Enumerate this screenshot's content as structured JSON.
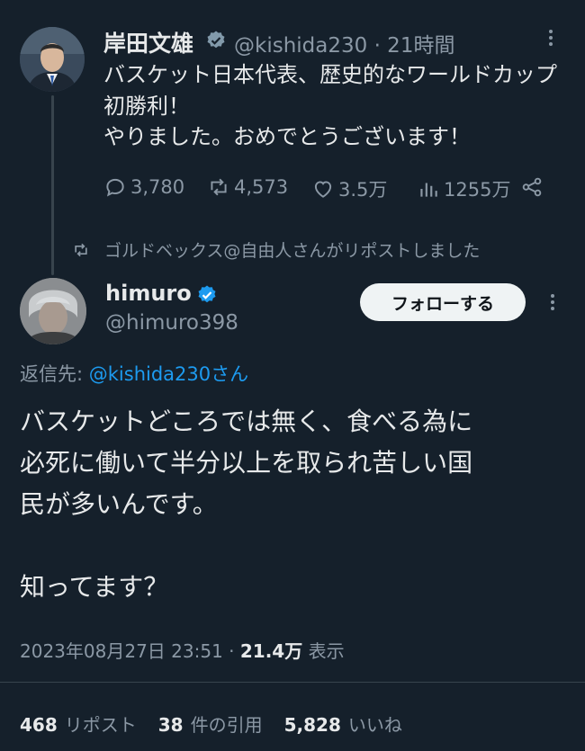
{
  "original_tweet": {
    "author_name": "岸田文雄",
    "handle_time": "@kishida230 · 21時間",
    "text": "バスケット日本代表、歴史的なワールドカップ初勝利！\nやりました。おめでとうございます！",
    "replies": "3,780",
    "reposts": "4,573",
    "likes": "3.5万",
    "views": "1255万"
  },
  "repost_notice": "ゴルドベックス@自由人さんがリポストしました",
  "reply_tweet": {
    "author_name": "himuro",
    "handle": "@himuro398",
    "follow_label": "フォローする",
    "reply_to_prefix": "返信先: ",
    "reply_to_handle": "@kishida230さん",
    "text": "バスケットどころでは無く、食べる為に\n必死に働いて半分以上を取られ苦しい国\n民が多いんです。\n\n知ってます？",
    "timestamp": "2023年08月27日 23:51 · ",
    "views_count": "21.4万",
    "views_label": " 表示",
    "reposts_count": "468",
    "reposts_label": "リポスト",
    "quotes_count": "38",
    "quotes_label": "件の引用",
    "likes_count": "5,828",
    "likes_label": "いいね"
  },
  "colors": {
    "background": "#15202b",
    "accent": "#1d9bf0",
    "muted": "#8b98a5"
  }
}
